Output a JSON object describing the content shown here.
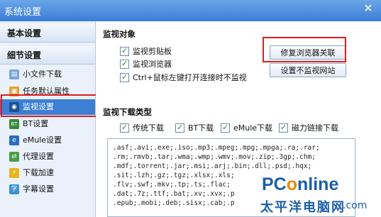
{
  "window": {
    "title": "系统设置",
    "close": "✕"
  },
  "sidebar": {
    "basic": "基本设置",
    "detail": "细节设置",
    "items": [
      {
        "label": "小文件下载",
        "icon": "file-icon",
        "glyph": "▤"
      },
      {
        "label": "任务默认属性",
        "icon": "task-icon",
        "glyph": "▣"
      },
      {
        "label": "监视设置",
        "icon": "monitor-icon",
        "glyph": "◉"
      },
      {
        "label": "BT设置",
        "icon": "bt-icon",
        "glyph": "BT"
      },
      {
        "label": "eMule设置",
        "icon": "emule-icon",
        "glyph": "e"
      },
      {
        "label": "代理设置",
        "icon": "proxy-icon",
        "glyph": "⇄"
      },
      {
        "label": "下载加速",
        "icon": "accelerate-icon",
        "glyph": "⚡"
      },
      {
        "label": "字幕设置",
        "icon": "subtitle-icon",
        "glyph": "字"
      }
    ]
  },
  "monitor": {
    "heading": "监视对象",
    "options": [
      "监视剪贴板",
      "监视浏览器",
      "Ctrl+鼠标左键打开连接时不监视"
    ],
    "repair_button": "修复浏览器关联",
    "nonmonitor_button": "设置不监视网站"
  },
  "download_types": {
    "heading": "监视下载类型",
    "options": [
      "传统下载",
      "BT下载",
      "eMule下载",
      "磁力链接下载"
    ],
    "extensions": ".asf;.avi;.exe;.iso;.mp3;.mpeg;.mpg;.mpga;.ra;.rar;\n.rm;.rmvb;.tar;.wma;.wmp;.wmv;.mov;.zip;.3gp;.chm;\n.mdf;.torrent;.jar;.msi;.arj;.bin;.dll;.psd;.hqx;\n.sit;.lzh;.gz;.tgz;.xlsx;.xls;\n.flv;.swf;.mkv;.tp;.ts;.flac;\n.dat;.7z;.ttf;.bat;.xv;.xvx;.p\n.epub;.mobi;.deb;.sisx;.cab;.p"
  },
  "watermark": {
    "brand_p": "PC",
    "brand_o": "o",
    "brand_rest": "nline",
    "cn": "太平洋电脑网",
    "dotcom": ".com"
  },
  "colors": {
    "accent": "#3c7fd4",
    "highlight": "#e21b1b"
  }
}
